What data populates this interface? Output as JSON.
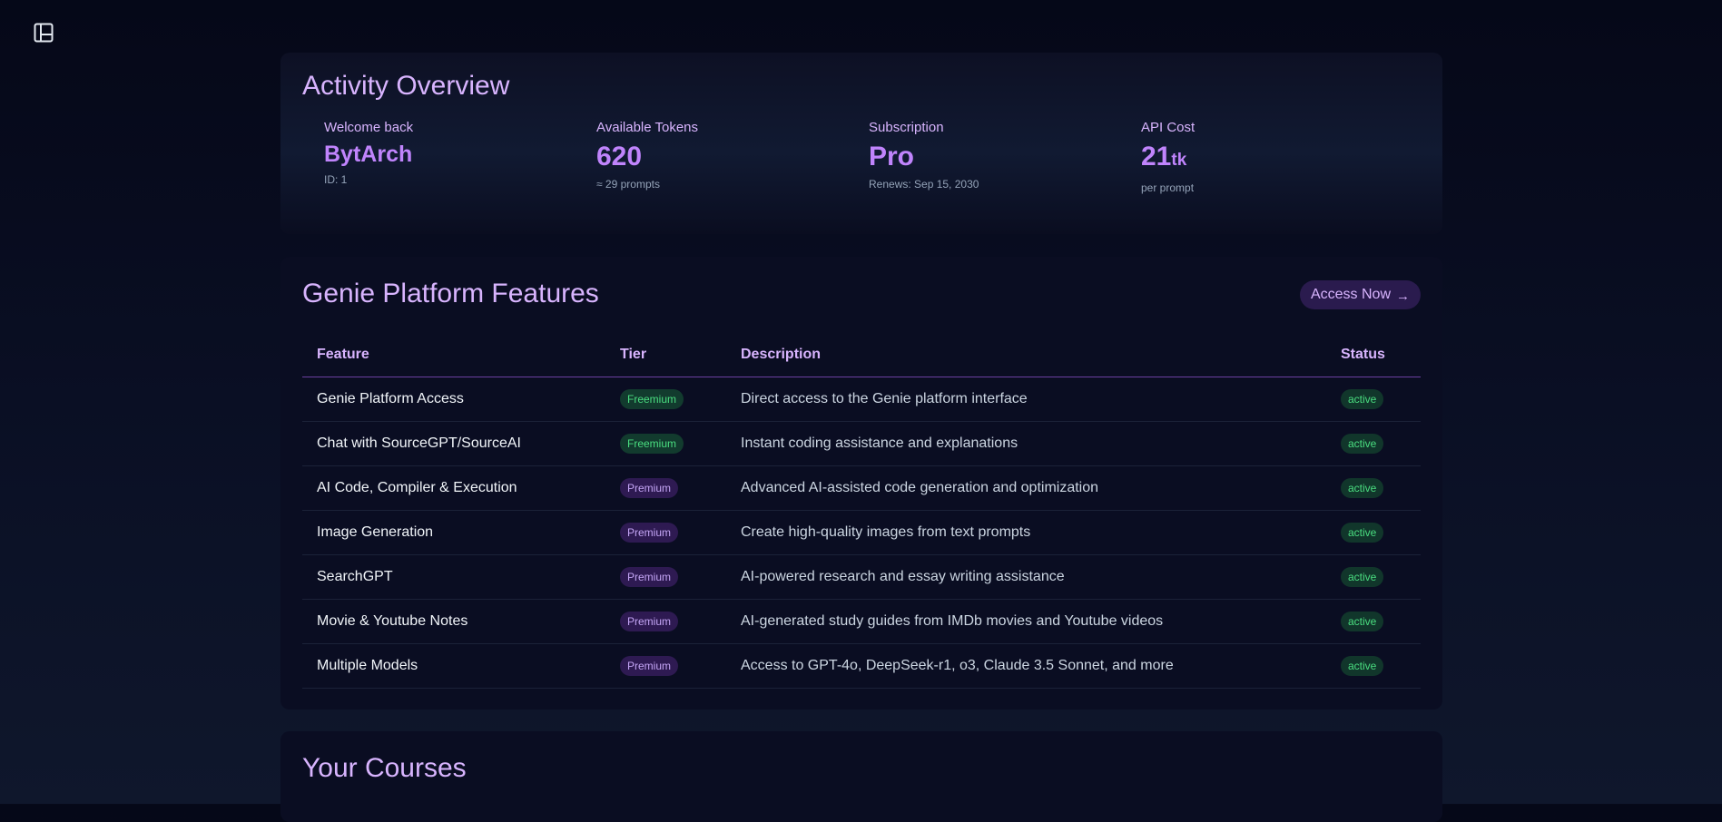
{
  "topbar": {
    "toggle_icon": "sidebar-toggle-icon"
  },
  "overview": {
    "title": "Activity Overview",
    "welcome": {
      "label": "Welcome back",
      "name": "BytArch",
      "id_text": "ID: 1"
    },
    "tokens": {
      "label": "Available Tokens",
      "value": "620",
      "sub": "≈ 29 prompts"
    },
    "subscription": {
      "label": "Subscription",
      "value": "Pro",
      "sub": "Renews: Sep 15, 2030"
    },
    "api_cost": {
      "label": "API Cost",
      "value": "21",
      "unit": "tk",
      "sub": "per prompt"
    }
  },
  "features": {
    "title": "Genie Platform Features",
    "access_button": "Access Now",
    "access_arrow": "→",
    "columns": {
      "feature": "Feature",
      "tier": "Tier",
      "description": "Description",
      "status": "Status"
    },
    "rows": [
      {
        "feature": "Genie Platform Access",
        "tier": "Freemium",
        "description": "Direct access to the Genie platform interface",
        "status": "active"
      },
      {
        "feature": "Chat with SourceGPT/SourceAI",
        "tier": "Freemium",
        "description": "Instant coding assistance and explanations",
        "status": "active"
      },
      {
        "feature": "AI Code, Compiler & Execution",
        "tier": "Premium",
        "description": "Advanced AI-assisted code generation and optimization",
        "status": "active"
      },
      {
        "feature": "Image Generation",
        "tier": "Premium",
        "description": "Create high-quality images from text prompts",
        "status": "active"
      },
      {
        "feature": "SearchGPT",
        "tier": "Premium",
        "description": "AI-powered research and essay writing assistance",
        "status": "active"
      },
      {
        "feature": "Movie & Youtube Notes",
        "tier": "Premium",
        "description": "AI-generated study guides from IMDb movies and Youtube videos",
        "status": "active"
      },
      {
        "feature": "Multiple Models",
        "tier": "Premium",
        "description": "Access to GPT-4o, DeepSeek-r1, o3, Claude 3.5 Sonnet, and more",
        "status": "active"
      }
    ]
  },
  "courses": {
    "title": "Your Courses"
  },
  "colors": {
    "accent": "#c084fc",
    "accent_light": "#d8b4fe",
    "freemium_badge": "#4ade80",
    "premium_badge": "#c4a5f5",
    "active_badge": "#4ade80"
  }
}
